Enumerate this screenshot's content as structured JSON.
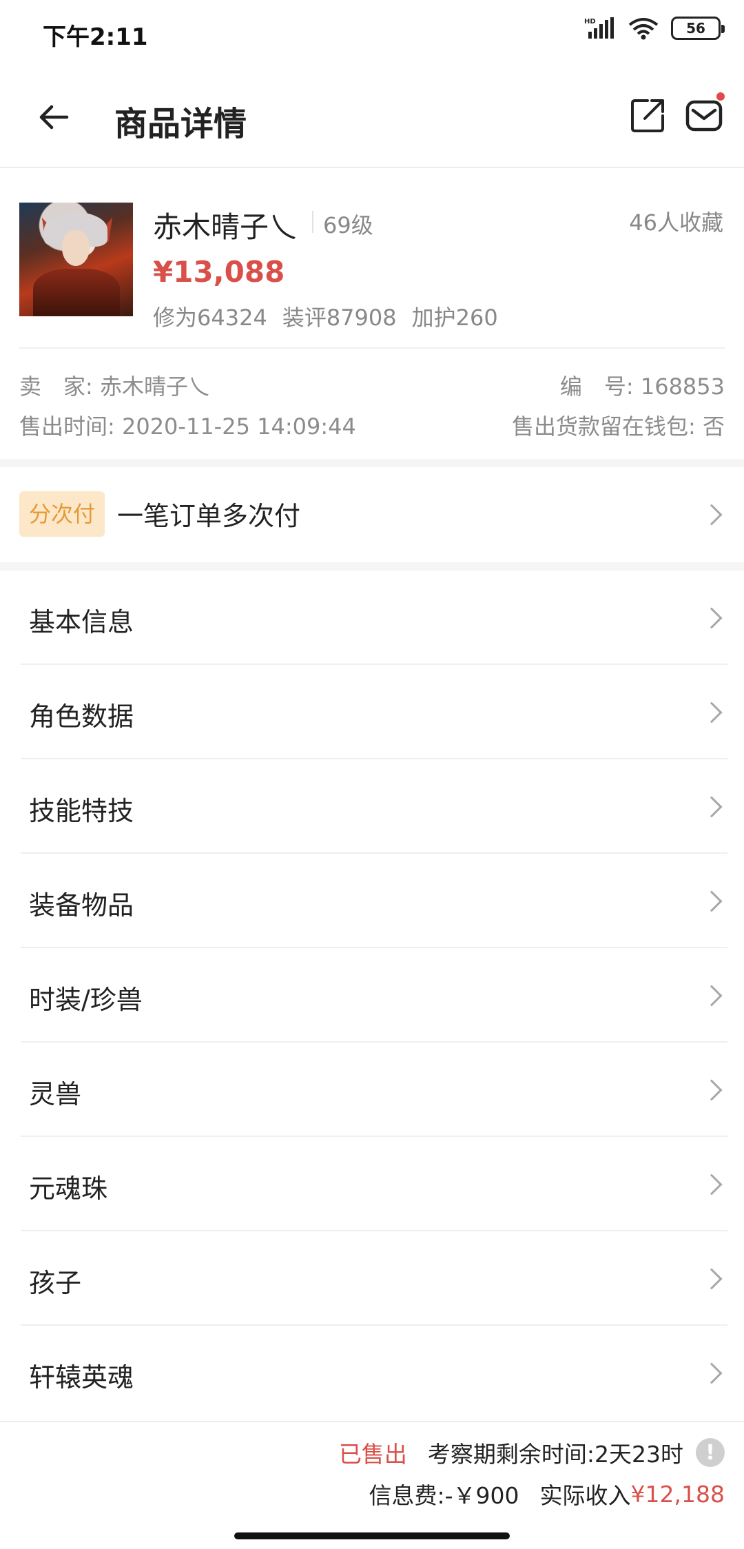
{
  "status_bar": {
    "time": "下午2:11",
    "battery": "56"
  },
  "header": {
    "title": "商品详情"
  },
  "product": {
    "name": "赤木晴子乀",
    "level": "69级",
    "favorites": "46人收藏",
    "price": "¥13,088",
    "stats": [
      "修为64324",
      "装评87908",
      "加护260"
    ],
    "seller_label": "卖　家:",
    "seller": "赤木晴子乀",
    "id_label": "编　号:",
    "id": "168853",
    "sold_time_label": "售出时间:",
    "sold_time": "2020-11-25 14:09:44",
    "wallet_label": "售出货款留在钱包:",
    "wallet": "否"
  },
  "installment": {
    "tag": "分次付",
    "text": "一笔订单多次付"
  },
  "menu": {
    "items": [
      {
        "label": "基本信息"
      },
      {
        "label": "角色数据"
      },
      {
        "label": "技能特技"
      },
      {
        "label": "装备物品"
      },
      {
        "label": "时装/珍兽"
      },
      {
        "label": "灵兽"
      },
      {
        "label": "元魂珠"
      },
      {
        "label": "孩子"
      },
      {
        "label": "轩辕英魂"
      }
    ]
  },
  "bottom": {
    "status": "已售出",
    "remaining_label": "考察期剩余时间:",
    "remaining": "2天23时",
    "info_icon": "!",
    "fee_label": "信息费:",
    "fee": "-￥900",
    "income_label": "实际收入",
    "income": "¥12,188"
  },
  "colors": {
    "accent_red": "#d9504a",
    "tag_orange": "#e59a38",
    "tag_bg": "#fde7c9"
  }
}
